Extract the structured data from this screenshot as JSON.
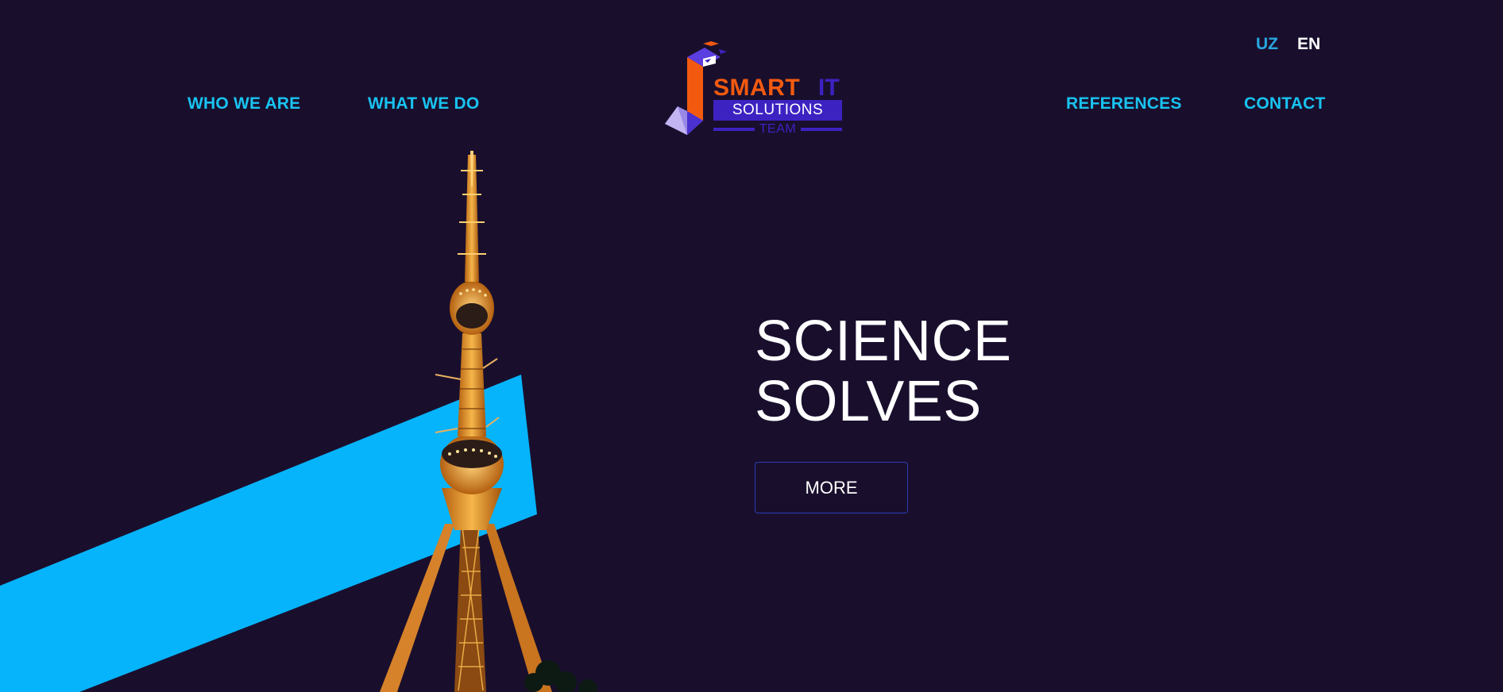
{
  "colors": {
    "background": "#190f2d",
    "nav_text": "#19c3f0",
    "accent_blue": "#06b4fb",
    "logo_orange": "#f35a10",
    "logo_purple": "#3d22c2",
    "button_border": "#2a3cb8"
  },
  "language": {
    "uz": "UZ",
    "en": "EN",
    "active": "EN"
  },
  "nav": {
    "who_we_are": "WHO WE ARE",
    "what_we_do": "WHAT WE DO",
    "references": "REFERENCES",
    "contact": "CONTACT"
  },
  "logo": {
    "smart": "SMART",
    "it": "IT",
    "solutions": "SOLUTIONS",
    "team": "TEAM"
  },
  "hero": {
    "title_line1": "SCIENCE",
    "title_line2": "SOLVES",
    "more_button": "MORE"
  },
  "icons": {
    "logo_mark": "geometric-cube-logo-icon",
    "hero_image": "tv-tower-illustration"
  }
}
